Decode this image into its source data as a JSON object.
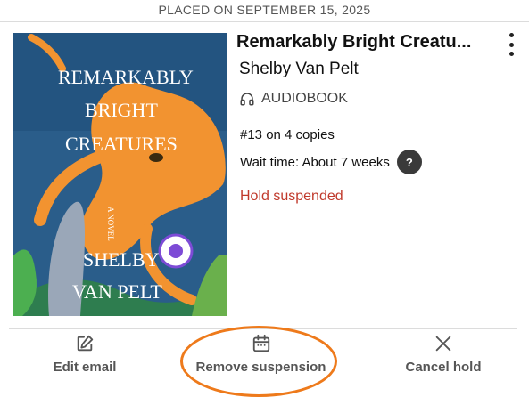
{
  "header": {
    "placed_text": "PLACED ON SEPTEMBER 15, 2025"
  },
  "book": {
    "title": "Remarkably Bright Creatu...",
    "author": "Shelby Van Pelt",
    "format": "AUDIOBOOK",
    "cover": {
      "title_lines": [
        "REMARKABLY",
        "BRIGHT",
        "CREATURES"
      ],
      "subtitle": "A NOVEL",
      "author_lines": [
        "SHELBY",
        "VAN PELT"
      ]
    }
  },
  "hold": {
    "queue_text": "#13 on 4 copies",
    "wait_text": "Wait time: About 7 weeks",
    "help_label": "?",
    "status": "Hold suspended"
  },
  "actions": {
    "edit_email": "Edit email",
    "remove_suspension": "Remove suspension",
    "cancel_hold": "Cancel hold"
  },
  "icons": {
    "menu": "kebab-menu-icon",
    "format": "headphones-icon",
    "edit": "pencil-square-icon",
    "calendar": "calendar-icon",
    "close": "close-icon"
  },
  "colors": {
    "status": "#c0392b",
    "highlight": "#ee7a1b",
    "octopus": "#f29330",
    "cover_bg": "#2a5d8a"
  }
}
